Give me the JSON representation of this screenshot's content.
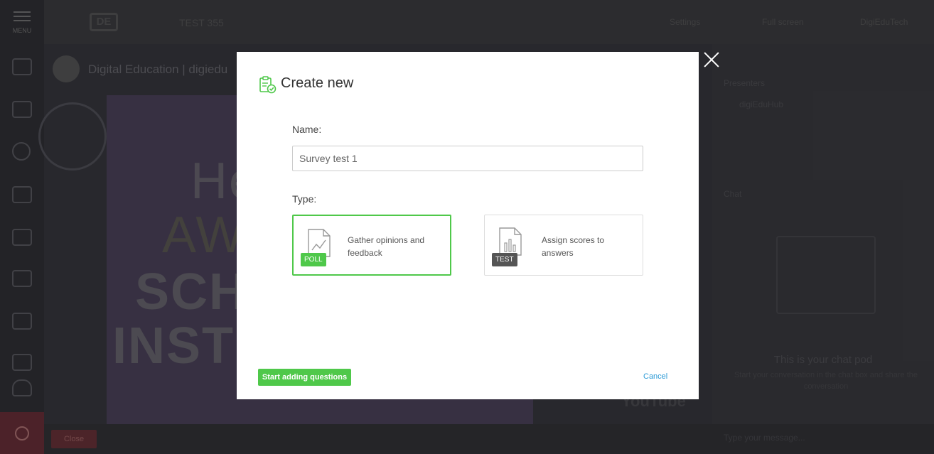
{
  "app": {
    "menu_label": "MENU",
    "session_title": "TEST 355",
    "logo_text": "DE",
    "topbar_items": [
      "Settings",
      "Full screen",
      "DigiEduTech"
    ],
    "channel_name": "Digital Education | digiedu",
    "slide_words": [
      "He",
      "AWE",
      "SCHO",
      "INSTIT"
    ],
    "close_label": "Close",
    "youtube_label": "YouTube",
    "right_panel": {
      "section1": "Presenters",
      "presenter": "digiEduHub",
      "section2": "Chat",
      "chat_title": "This is your chat pod",
      "chat_sub": "Start your conversation in the chat box and share the conversation",
      "message_placeholder": "Type your message..."
    }
  },
  "modal": {
    "title": "Create new",
    "header_icon": "clipboard-check-icon",
    "name_label": "Name:",
    "name_value": "Survey test 1",
    "type_label": "Type:",
    "types": [
      {
        "badge": "POLL",
        "description": "Gather opinions and feedback",
        "icon": "chart-document-icon",
        "selected": true
      },
      {
        "badge": "TEST",
        "description": "Assign scores to answers",
        "icon": "bar-chart-document-icon",
        "selected": false
      }
    ],
    "start_button": "Start adding questions",
    "cancel_link": "Cancel",
    "accent_color": "#4fc84a",
    "link_color": "#2b9ad6"
  }
}
